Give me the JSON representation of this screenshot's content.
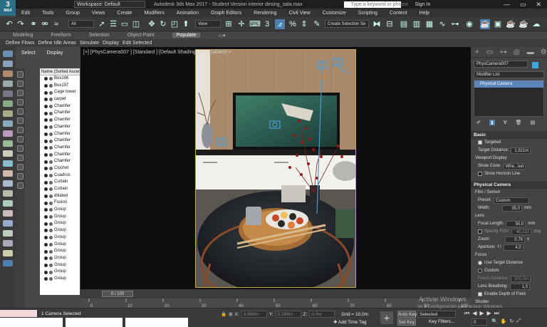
{
  "app": {
    "logo_main": "3",
    "logo_sub": "MAX",
    "workspace": "Workspace: Default",
    "title": "Autodesk 3ds Max 2017 - Student Version   interior desing_sala.max",
    "search_placeholder": "Type a keyword or phrase",
    "signin": "Sign In",
    "window_buttons": [
      "—",
      "▭",
      "✕"
    ]
  },
  "menu": [
    "Edit",
    "Tools",
    "Group",
    "Views",
    "Create",
    "Modifiers",
    "Animation",
    "Graph Editors",
    "Rendering",
    "Civil View",
    "Customize",
    "Scripting",
    "Content",
    "Help"
  ],
  "toolbar": {
    "selection_filter": "All",
    "view_dropdown": "View",
    "create_selection_set": "Create Selection Se",
    "angle_snap": "3"
  },
  "ribbon": {
    "tabs": [
      "Modeling",
      "Freeform",
      "Selection",
      "Object Paint",
      "Populate"
    ],
    "active_tab": "Populate",
    "subtabs": [
      "Define Flows",
      "Define Idle Areas",
      "Simulate",
      "Display",
      "Edit Selected"
    ]
  },
  "explorer": {
    "tabs": [
      "Select",
      "Display"
    ],
    "column_header": "Name (Sorted Ascending)",
    "items": [
      "Box196",
      "Box197",
      "Cage tower",
      "carpet",
      "Chamfer",
      "Chamfer",
      "Chamfer",
      "Chamfer",
      "Chamfer",
      "Chamfer",
      "Chamfer",
      "Chamfer",
      "Chamfer",
      "Clochet",
      "Cuadros",
      "Curtain",
      "Curtain",
      "diliated",
      "Fusion",
      "Group",
      "Group",
      "Group",
      "Group",
      "Group",
      "Group",
      "Group",
      "Group",
      "Group",
      "Group",
      "Group"
    ]
  },
  "viewport": {
    "label": "[+] [PhysCamera007 ] [Standard ] [Default Shading ]  <<Disabled>>"
  },
  "right_panel": {
    "object_name": "PhysCamera007",
    "modifier_list": "Modifier List",
    "stack_item": "Physical Camera",
    "basic": {
      "header": "Basic",
      "targeted": "Targeted",
      "target_distance_label": "Target Distance:",
      "target_distance": "1,921m",
      "viewport_display": "Viewport Display",
      "show_cone_label": "Show Cone:",
      "show_cone": "Whe...ted",
      "show_horizon": "Show Horizon Line"
    },
    "physical": {
      "header": "Physical Camera",
      "film_sensor": "Film / Sensor",
      "preset_label": "Preset:",
      "preset": "Custom",
      "width_label": "Width:",
      "width": "35,0",
      "width_unit": "mm",
      "lens": "Lens",
      "focal_label": "Focal Length:",
      "focal": "50,0",
      "focal_unit": "mm",
      "fov_label": "Specify FOV:",
      "fov": "40,222",
      "fov_unit": "deg",
      "zoom_label": "Zoom:",
      "zoom": "0,76",
      "zoom_unit": "x",
      "aperture_label": "Aperture:",
      "aperture_prefix": "f /",
      "aperture": "4,0",
      "focus": "Focus",
      "use_target": "Use Target Distance",
      "custom": "Custom",
      "focus_dist_label": "Focus Distance:",
      "focus_dist": "300,0m",
      "lens_breathing_label": "Lens Breathing:",
      "lens_breathing": "1,0",
      "enable_dof": "Enable Depth of Field",
      "shutter": "Shutter"
    }
  },
  "timeline": {
    "frame": "0 / 100",
    "ticks": [
      "0",
      "10",
      "20",
      "30",
      "40",
      "50",
      "60",
      "70",
      "80",
      "90",
      "100"
    ]
  },
  "status": {
    "selected": "1 Camera Selected",
    "x_label": "X:",
    "x": "9,988m",
    "y_label": "Y:",
    "y": "5,389m",
    "z_label": "Z:",
    "z": "0,0m",
    "grid": "Grid = 10,0m",
    "add_time_tag": "Add Time Tag",
    "autokey": "Auto Key",
    "setkey": "Set Key",
    "selected_dropdown": "Selected",
    "key_filters": "Key Filters...",
    "frame_field": "0",
    "watermark_line1": "Activar Windows",
    "watermark_line2": "Ve a Configuración para activar Windows."
  }
}
